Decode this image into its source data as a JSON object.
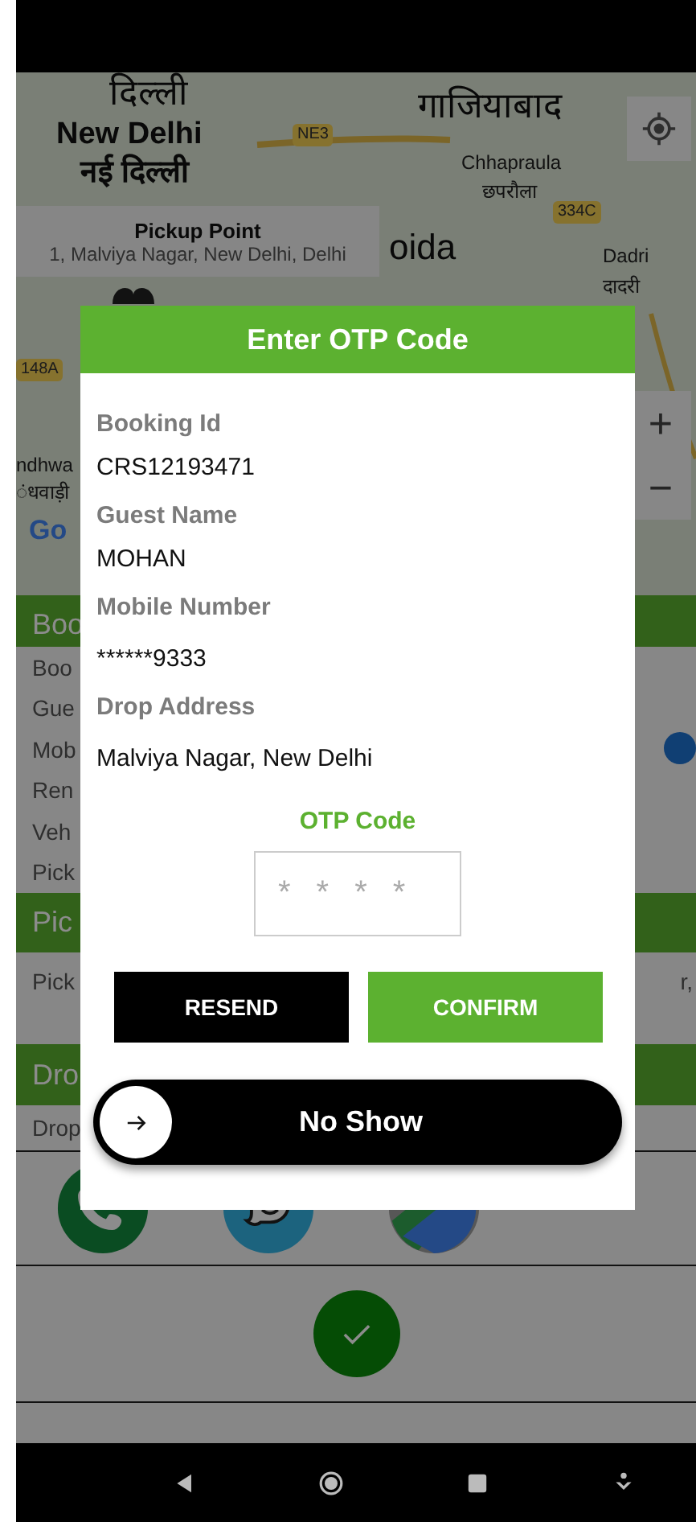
{
  "map": {
    "labels": [
      {
        "text": "दिल्ली",
        "kind": "place"
      },
      {
        "text": "गाजियाबाद",
        "kind": "place"
      },
      {
        "text": "New Delhi",
        "kind": "city"
      },
      {
        "text": "नई दिल्ली",
        "kind": "city"
      },
      {
        "text": "NE3",
        "kind": "road"
      },
      {
        "text": "Chhapraula",
        "kind": "small"
      },
      {
        "text": "छपरौला",
        "kind": "small"
      },
      {
        "text": "334C",
        "kind": "road"
      },
      {
        "text": "oida",
        "kind": "place"
      },
      {
        "text": "Dadri",
        "kind": "small"
      },
      {
        "text": "दादरी",
        "kind": "small"
      },
      {
        "text": "148A",
        "kind": "road"
      },
      {
        "text": "ndhwa",
        "kind": "small"
      },
      {
        "text": "ंधवाड़ी",
        "kind": "small"
      },
      {
        "text": "Go",
        "kind": "logo"
      }
    ],
    "pickup_label": {
      "title": "Pickup Point",
      "address": "1, Malviya Nagar, New Delhi, Delhi"
    },
    "zoom_in": "+",
    "zoom_out": "−"
  },
  "sections": [
    {
      "title": "Boo",
      "rows": [
        {
          "text": "Boo"
        },
        {
          "text": "Gue"
        },
        {
          "text": "Mob",
          "action_icon": true
        },
        {
          "text": "Ren"
        },
        {
          "text": "Veh"
        },
        {
          "text": "Pick"
        }
      ]
    },
    {
      "title": "Pic",
      "rows": [
        {
          "text": "Pick",
          "tail": "r,"
        }
      ]
    },
    {
      "title": "Dro",
      "rows": [
        {
          "text": "Drop"
        }
      ]
    }
  ],
  "dialog": {
    "title": "Enter OTP Code",
    "fields": [
      {
        "label": "Booking Id",
        "value": "CRS12193471"
      },
      {
        "label": "Guest Name",
        "value": "MOHAN"
      },
      {
        "label": "Mobile Number",
        "value": "******9333"
      },
      {
        "label": "Drop Address",
        "value": "Malviya Nagar, New Delhi"
      }
    ],
    "otp": {
      "label": "OTP Code",
      "placeholder": "****"
    },
    "buttons": [
      {
        "label": "RESEND",
        "kind": "secondary"
      },
      {
        "label": "CONFIRM",
        "kind": "primary"
      }
    ],
    "slider": {
      "label": "No Show",
      "level": 0
    }
  }
}
